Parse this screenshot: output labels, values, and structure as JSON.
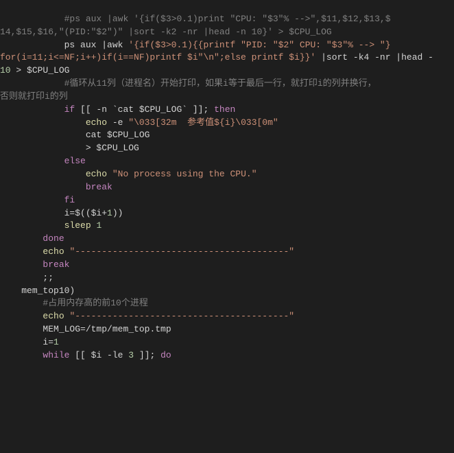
{
  "lines": {
    "0": "#ps aux |awk '{if($3>0.1)print \"CPU: \"$3\"% -->\",$11,$12,$13,$",
    "1": "14,$15,$16,\"(PID:\"$2\")\" |sort -k2 -nr |head -n 10}' > $CPU_LOG",
    "2a": "ps aux |awk",
    "2b": "'{if($3>0.1){{printf \"PID: \"$2\" CPU: \"$3\"% --> \"}",
    "3a": "for(i=11;i<=NF;i++)if(i==NF)printf $i\"\\n\";else printf $i}}'",
    "3b": "|sort -k4 -nr |head -",
    "4a": "10",
    "4b": "> $CPU_LOG",
    "5": "#循环从11列（进程名）开始打印，如果i等于最后一行，就打印i的列并换行，",
    "6": "否则就打印i的列",
    "7a": "if",
    "7b": "[[ -n `cat $CPU_LOG` ]];",
    "7c": "then",
    "8a": "echo",
    "8b": "-e",
    "8c": "\"\\033[32m  参考值${i}\\033[0m\"",
    "9": "cat $CPU_LOG",
    "10": "> $CPU_LOG",
    "11": "else",
    "12a": "echo",
    "12b": "\"No process using the CPU.\"",
    "13": "break",
    "14": "fi",
    "15a": "i=$(($i+",
    "15b": "1",
    "15c": "))",
    "16a": "sleep",
    "16b": "1",
    "17": "done",
    "18a": "echo",
    "18b": "\"----------------------------------------\"",
    "19": "break",
    "20": ";;",
    "21": "mem_top10)",
    "22": "#占用内存高的前10个进程",
    "23a": "echo",
    "23b": "\"----------------------------------------\"",
    "24": "MEM_LOG=/tmp/mem_top.tmp",
    "25a": "i=",
    "25b": "1",
    "26a": "while",
    "26b": "[[ $i -le",
    "26c": "3",
    "26d": "]];",
    "26e": "do"
  }
}
